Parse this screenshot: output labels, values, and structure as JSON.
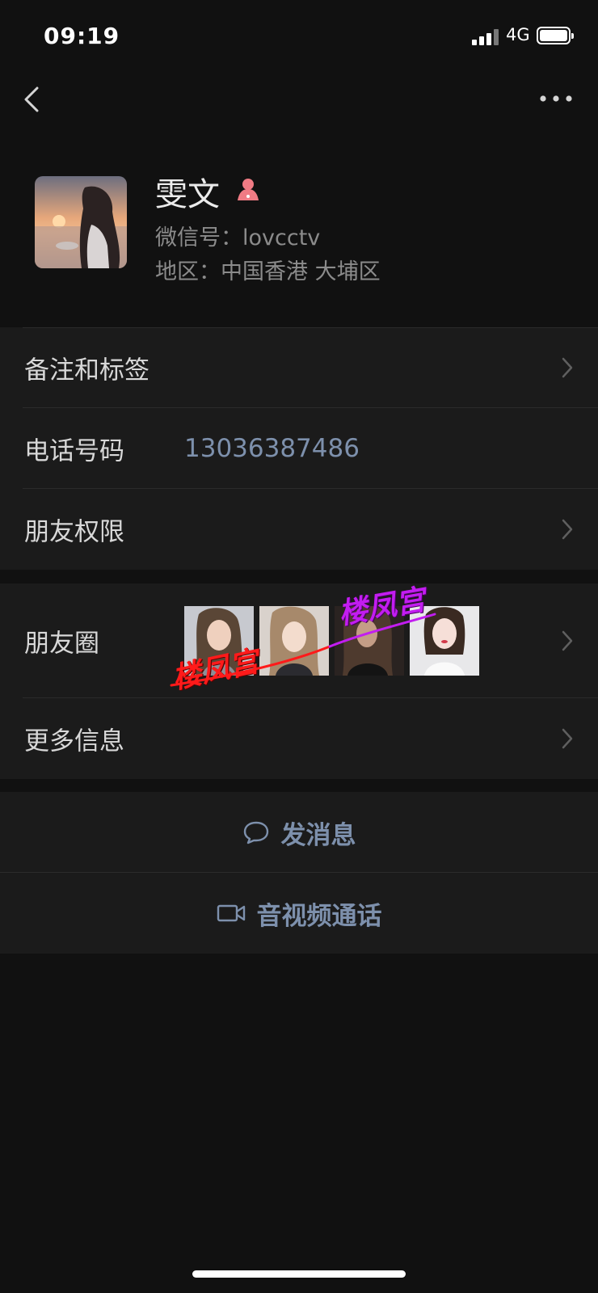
{
  "status": {
    "time": "09:19",
    "network": "4G"
  },
  "profile": {
    "name": "雯文",
    "wechat_id_line": "微信号：lovcctv",
    "region_line": "地区：中国香港 大埔区"
  },
  "rows": {
    "remarks_label": "备注和标签",
    "phone_label": "电话号码",
    "phone_value": "13036387486",
    "permissions_label": "朋友权限",
    "moments_label": "朋友圈",
    "more_info_label": "更多信息"
  },
  "watermarks": [
    "楼凤宫",
    "楼凤宫"
  ],
  "actions": {
    "message_label": "发消息",
    "call_label": "音视频通话"
  },
  "colors": {
    "background": "#111111",
    "panel": "#1b1b1b",
    "link": "#7d90ac",
    "watermark_red": "#ff1a1a",
    "watermark_purple": "#c21df0"
  }
}
